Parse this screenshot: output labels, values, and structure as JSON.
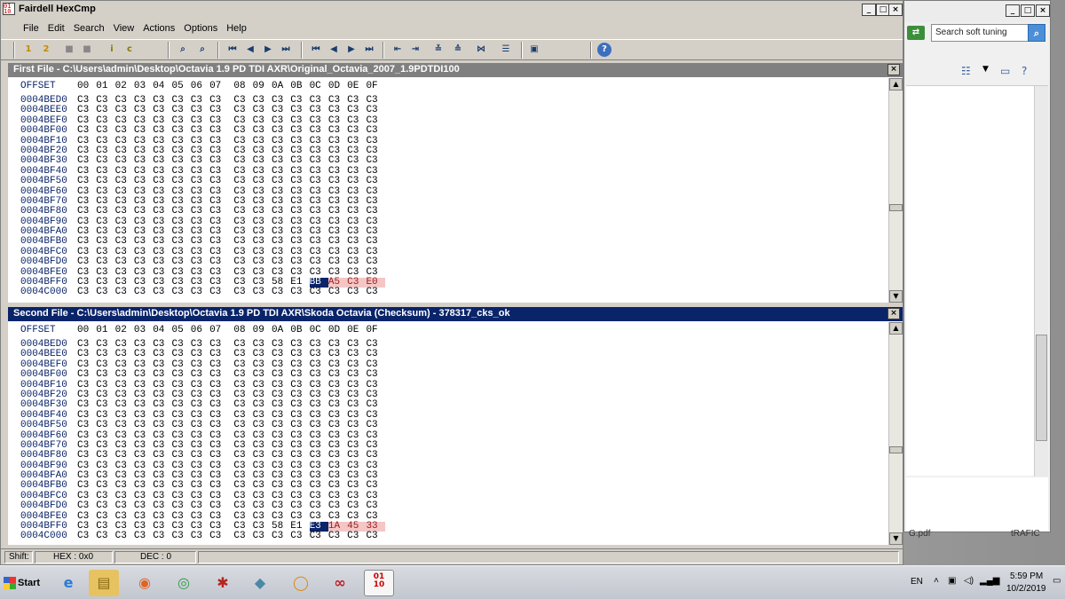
{
  "background_window": {
    "search_placeholder": "Search soft tuning",
    "files": [
      "G.pdf",
      "tRAFIC"
    ],
    "nav_icon": "refresh-arrows-icon",
    "search_icon": "magnifier-icon"
  },
  "app": {
    "title": "Fairdell HexCmp",
    "menu": [
      "File",
      "Edit",
      "Search",
      "View",
      "Actions",
      "Options",
      "Help"
    ]
  },
  "panes": {
    "first": {
      "title": "First File - C:\\Users\\admin\\Desktop\\Octavia 1.9 PD TDI AXR\\Original_Octavia_2007_1.9PDTDI100",
      "last_row_tail": [
        "58",
        "E1",
        "BB",
        "A5",
        "C3",
        "E0"
      ]
    },
    "second": {
      "title": "Second File - C:\\Users\\admin\\Desktop\\Octavia 1.9 PD TDI AXR\\Skoda Octavia (Checksum) - 378317_cks_ok",
      "last_row_tail": [
        "58",
        "E1",
        "E3",
        "1A",
        "45",
        "33"
      ]
    },
    "header": {
      "offset": "OFFSET",
      "cols": [
        "00",
        "01",
        "02",
        "03",
        "04",
        "05",
        "06",
        "07",
        "08",
        "09",
        "0A",
        "0B",
        "0C",
        "0D",
        "0E",
        "0F"
      ]
    },
    "offsets": [
      "0004BED0",
      "0004BEE0",
      "0004BEF0",
      "0004BF00",
      "0004BF10",
      "0004BF20",
      "0004BF30",
      "0004BF40",
      "0004BF50",
      "0004BF60",
      "0004BF70",
      "0004BF80",
      "0004BF90",
      "0004BFA0",
      "0004BFB0",
      "0004BFC0",
      "0004BFD0",
      "0004BFE0",
      "0004BFF0",
      "0004C000"
    ],
    "fill_byte": "C3"
  },
  "status": {
    "shift": "Shift:",
    "hex": "HEX : 0x0",
    "dec": "DEC : 0"
  },
  "taskbar": {
    "start": "Start",
    "lang": "EN",
    "time": "5:59 PM",
    "date": "10/2/2019"
  }
}
